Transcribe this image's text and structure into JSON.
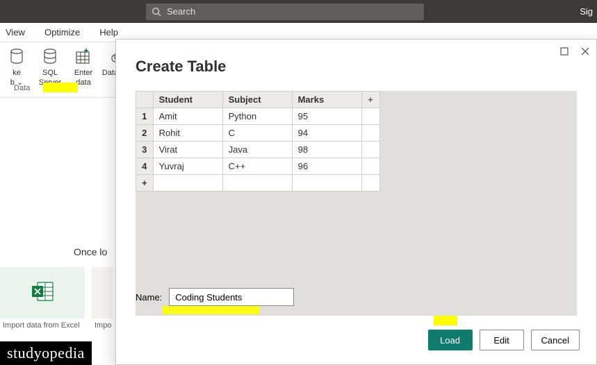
{
  "title_bar": {
    "search_placeholder": "Search",
    "sign": "Sig"
  },
  "menu": {
    "items": [
      "View",
      "Optimize",
      "Help"
    ]
  },
  "ribbon": {
    "buttons": [
      {
        "line1": "ke",
        "line2": "b ⌄"
      },
      {
        "line1": "SQL",
        "line2": "Server"
      },
      {
        "line1": "Enter",
        "line2": "data"
      },
      {
        "line1": "Dataverse",
        "line2": ""
      }
    ],
    "group_label": "Data"
  },
  "canvas": {
    "once_loaded": "Once lo",
    "cards": [
      {
        "label": "Import data from Excel"
      },
      {
        "label": "Impo"
      }
    ]
  },
  "dialog": {
    "title": "Create Table",
    "grid": {
      "headers": [
        "Student",
        "Subject",
        "Marks"
      ],
      "add_col": "+",
      "rows": [
        {
          "n": "1",
          "student": "Amit",
          "subject": "Python",
          "marks": "95"
        },
        {
          "n": "2",
          "student": "Rohit",
          "subject": "C",
          "marks": "94"
        },
        {
          "n": "3",
          "student": "Virat",
          "subject": "Java",
          "marks": "98"
        },
        {
          "n": "4",
          "student": "Yuvraj",
          "subject": "C++",
          "marks": "96"
        }
      ],
      "add_row": "+"
    },
    "name_label": "Name:",
    "name_value": "Coding Students",
    "buttons": {
      "load": "Load",
      "edit": "Edit",
      "cancel": "Cancel"
    }
  },
  "watermark": "studyopedia"
}
